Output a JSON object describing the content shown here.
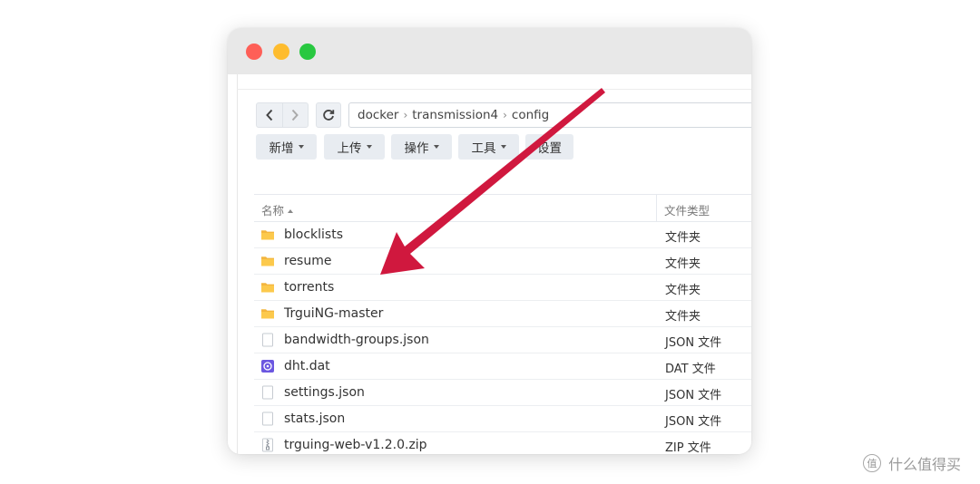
{
  "window": {
    "traffic_lights": [
      "#fe5f57",
      "#febc2e",
      "#28c840"
    ]
  },
  "nav": {
    "back_icon": "chevron-left-icon",
    "forward_icon": "chevron-right-icon",
    "refresh_icon": "refresh-icon"
  },
  "breadcrumb": [
    "docker",
    "transmission4",
    "config"
  ],
  "toolbar": {
    "create": "新增",
    "upload": "上传",
    "action": "操作",
    "tools": "工具",
    "settings": "设置"
  },
  "table": {
    "col_name": "名称",
    "col_type": "文件类型",
    "rows": [
      {
        "name": "blocklists",
        "type": "文件夹",
        "icon": "folder-icon"
      },
      {
        "name": "resume",
        "type": "文件夹",
        "icon": "folder-icon"
      },
      {
        "name": "torrents",
        "type": "文件夹",
        "icon": "folder-icon"
      },
      {
        "name": "TrguiNG-master",
        "type": "文件夹",
        "icon": "folder-icon"
      },
      {
        "name": "bandwidth-groups.json",
        "type": "JSON 文件",
        "icon": "file-icon"
      },
      {
        "name": "dht.dat",
        "type": "DAT 文件",
        "icon": "disk-image-icon"
      },
      {
        "name": "settings.json",
        "type": "JSON 文件",
        "icon": "file-icon"
      },
      {
        "name": "stats.json",
        "type": "JSON 文件",
        "icon": "file-icon"
      },
      {
        "name": "trguing-web-v1.2.0.zip",
        "type": "ZIP 文件",
        "icon": "zip-file-icon"
      }
    ]
  },
  "annotation": {
    "arrow_color": "#d0183e"
  },
  "watermark": {
    "badge": "值",
    "text": "什么值得买"
  }
}
